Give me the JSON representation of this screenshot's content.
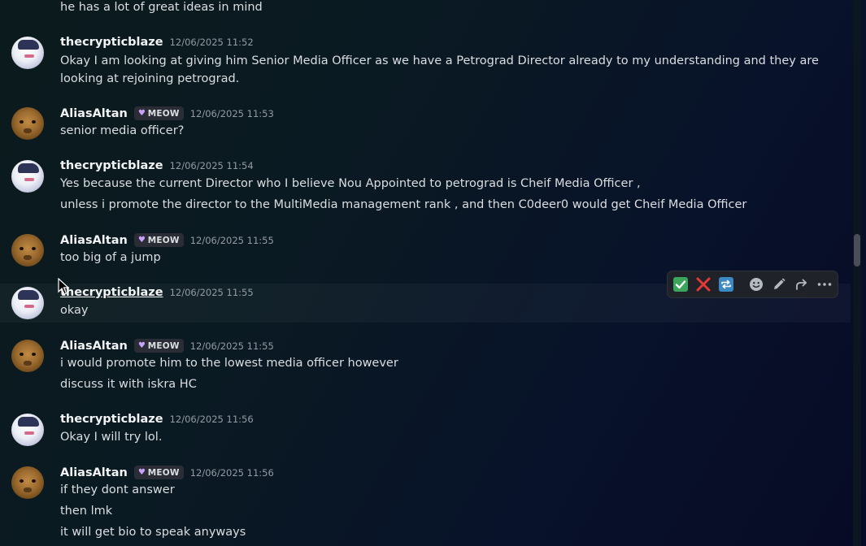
{
  "messages": [
    {
      "lines": [
        "he has a lot of great ideas in mind"
      ]
    },
    {
      "user": "thecrypticblaze",
      "timestamp": "12/06/2025 11:52",
      "lines": [
        "Okay I am looking at giving him Senior Media Officer as we have a Petrograd Director already to my understanding and they are looking at rejoining petrograd."
      ]
    },
    {
      "user": "AliasAltan",
      "tag": "MEOW",
      "timestamp": "12/06/2025 11:53",
      "lines": [
        "senior media officer?"
      ]
    },
    {
      "user": "thecrypticblaze",
      "timestamp": "12/06/2025 11:54",
      "lines": [
        "Yes because the current Director who I believe Nou Appointed to petrograd is Cheif Media Officer ,",
        "unless i promote the director to the MultiMedia management rank , and then C0deer0 would get Cheif Media Officer"
      ]
    },
    {
      "user": "AliasAltan",
      "tag": "MEOW",
      "timestamp": "12/06/2025 11:55",
      "lines": [
        "too big of a jump"
      ]
    },
    {
      "user": "thecrypticblaze",
      "timestamp": "12/06/2025 11:55",
      "lines": [
        "okay"
      ]
    },
    {
      "user": "AliasAltan",
      "tag": "MEOW",
      "timestamp": "12/06/2025 11:55",
      "lines": [
        "i would promote him to the lowest media officer however",
        "discuss it with iskra HC"
      ]
    },
    {
      "user": "thecrypticblaze",
      "timestamp": "12/06/2025 11:56",
      "lines": [
        "Okay I will try lol."
      ]
    },
    {
      "user": "AliasAltan",
      "tag": "MEOW",
      "timestamp": "12/06/2025 11:56",
      "lines": [
        "if they dont answer",
        "then lmk",
        "it will get bio to speak anyways"
      ]
    }
  ],
  "toolbar": {
    "icons": [
      "check-reaction-icon",
      "cross-reaction-icon",
      "repeat-reaction-icon",
      "add-reaction-icon",
      "edit-icon",
      "forward-icon",
      "more-icon"
    ],
    "colors": {
      "check": "#3ba55c",
      "cross": "#e53935",
      "repeat": "#3b88c3"
    }
  }
}
